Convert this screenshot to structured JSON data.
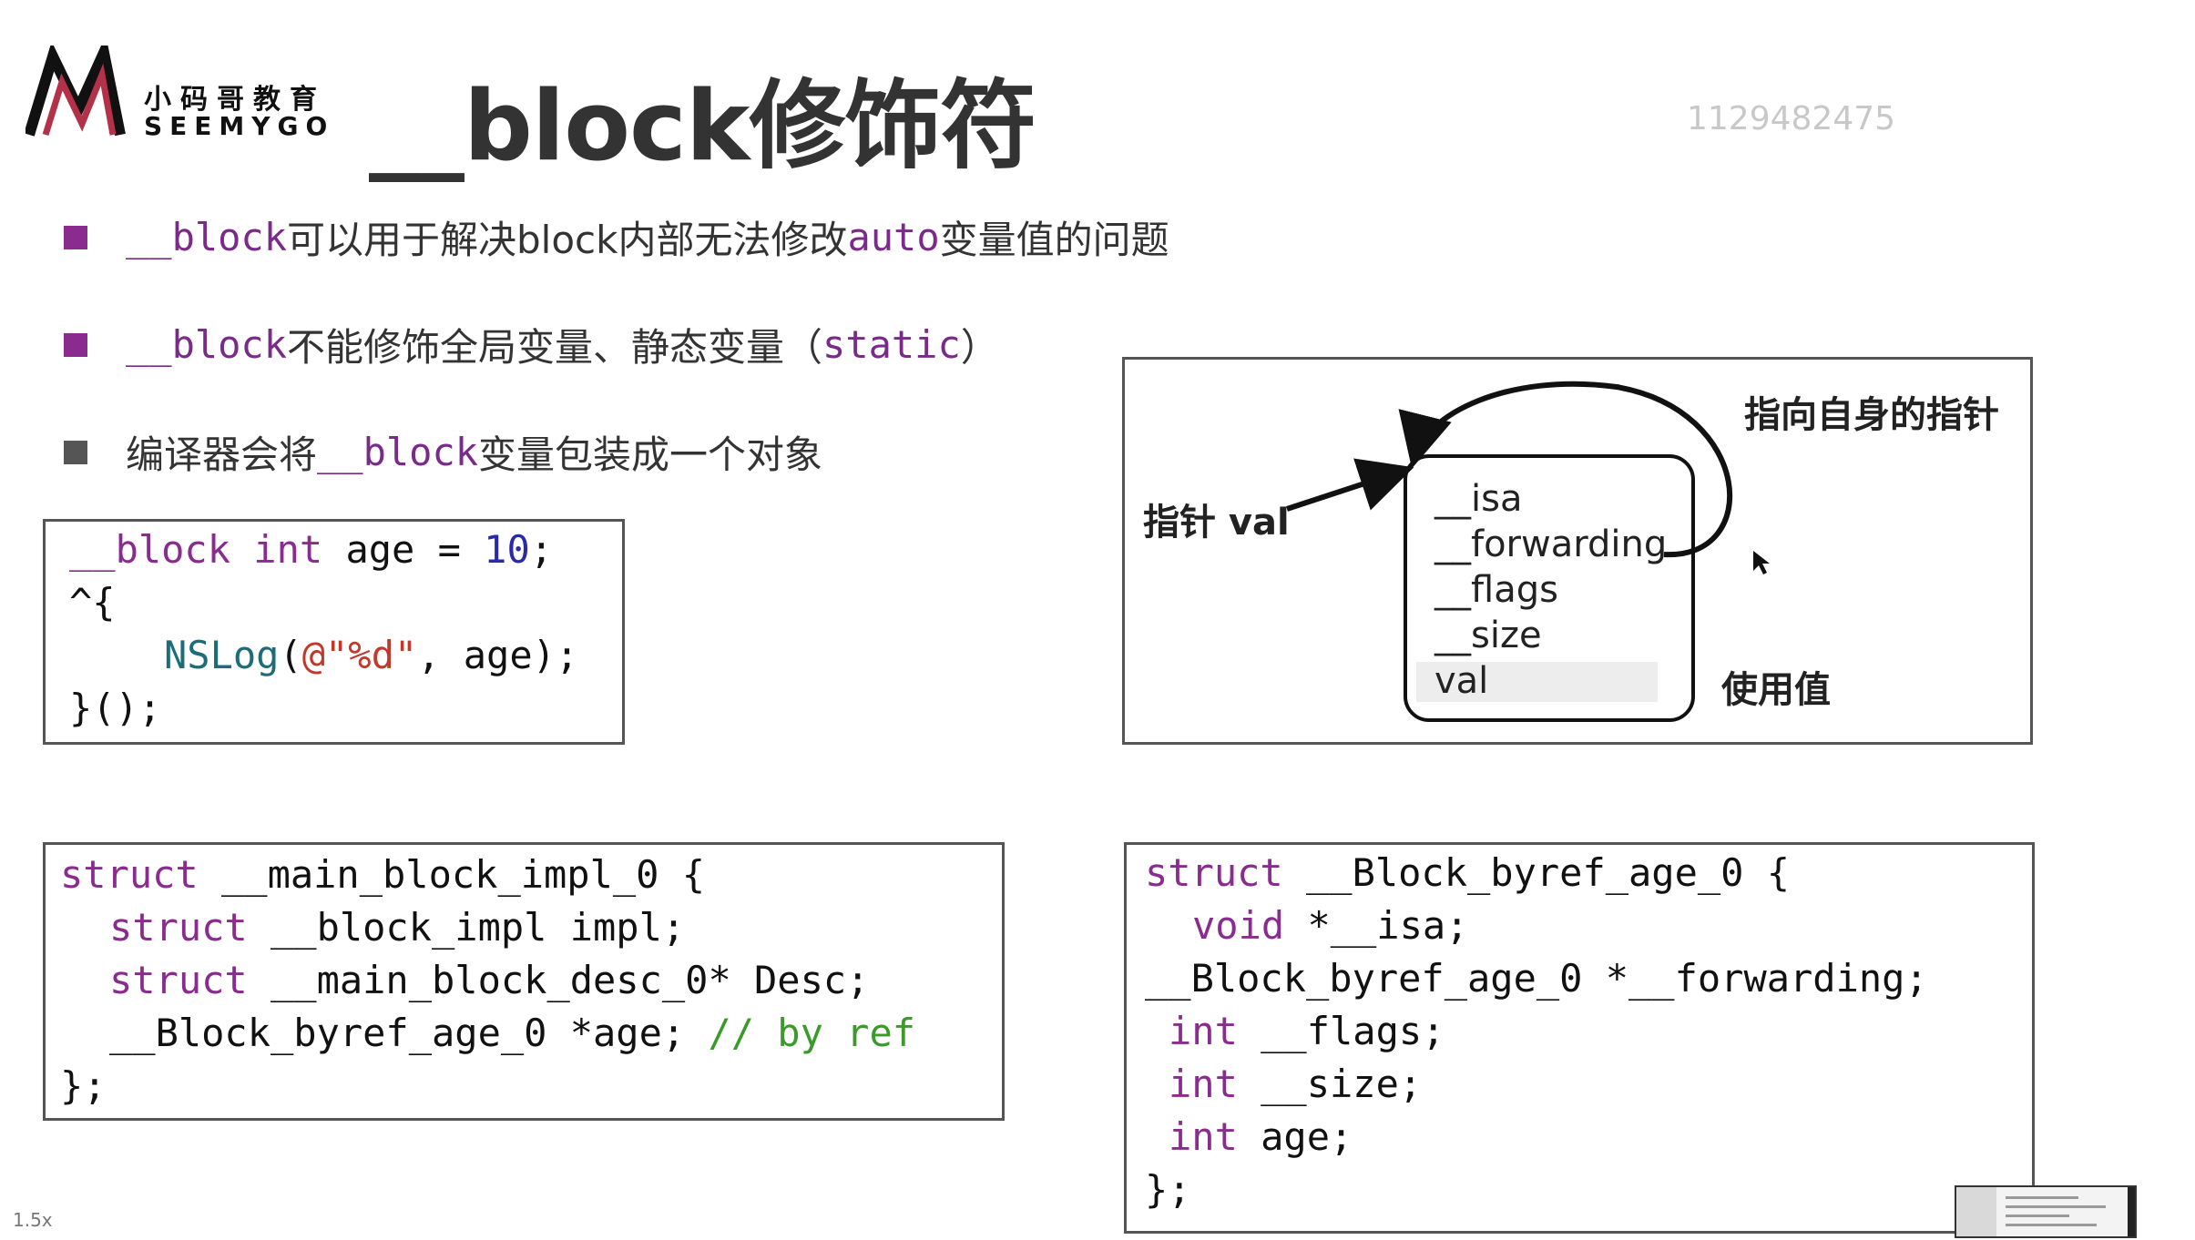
{
  "logo": {
    "cn": "小码哥教育",
    "en": "SEEMYGO"
  },
  "slide_title": "__block修饰符",
  "watermark": "1129482475",
  "colors": {
    "keyword": "#7a2a88",
    "bullet_purple": "#8a2c8f",
    "bullet_gray": "#555555",
    "comment": "#3a9a2a",
    "number": "#2a2aa8",
    "string": "#c0392b"
  },
  "bullets": [
    {
      "kw": "__block",
      "text": "可以用于解决block内部无法修改",
      "kw2": "auto",
      "text2": "变量值的问题"
    },
    {
      "kw": "__block",
      "text": "不能修饰全局变量、静态变量（",
      "kw2": "static",
      "text2": "）"
    },
    {
      "pre": "编译器会将",
      "kw": "__block",
      "text": "变量包装成一个对象"
    }
  ],
  "code_a": {
    "l1_kw": "__block int",
    "l1_rest": " age = ",
    "l1_num": "10",
    "l1_end": ";",
    "l2": "^{",
    "l3_fn": "NSLog",
    "l3_open": "(",
    "l3_str": "@\"%d\"",
    "l3_rest": ", age);",
    "l4": "}();"
  },
  "code_b": {
    "l1_kw": "struct",
    "l1_rest": " __main_block_impl_0 {",
    "l2_kw": "struct",
    "l2_rest": " __block_impl impl;",
    "l3_kw": "struct",
    "l3_rest": " __main_block_desc_0* Desc;",
    "l4_code": "__Block_byref_age_0 *age; ",
    "l4_comment": "// by ref",
    "l5": "};"
  },
  "code_c": {
    "l1_kw": "struct",
    "l1_rest": " __Block_byref_age_0 {",
    "l2_kw": "void",
    "l2_rest": " *__isa;",
    "l3": "__Block_byref_age_0 *__forwarding;",
    "l4_kw": "int",
    "l4_rest": " __flags;",
    "l5_kw": "int",
    "l5_rest": " __size;",
    "l6_kw": "int",
    "l6_rest": " age;",
    "l7": "};"
  },
  "diagram": {
    "pointer_label": "指针 val",
    "self_pointer_label": "指向自身的指针",
    "use_value_label": "使用值",
    "fields": [
      "__isa",
      "__forwarding",
      "__flags",
      "__size",
      "val"
    ]
  },
  "speed": "1.5x",
  "icons": {
    "logo": "seemygo-m-logo",
    "bullet": "square-bullet-icon",
    "cursor": "mouse-cursor-icon"
  }
}
